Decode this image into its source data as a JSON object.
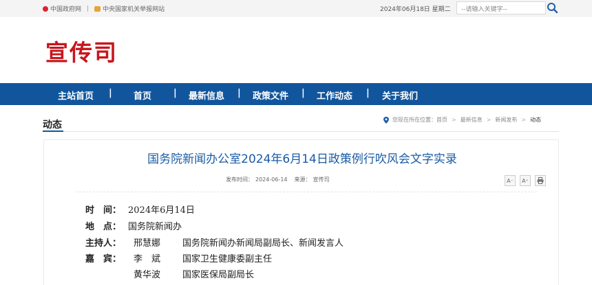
{
  "topbar": {
    "link1": "中国政府网",
    "divider": "|",
    "link2": "中央国家机关举报网站",
    "date": "2024年06月18日 星期二",
    "search_placeholder": "--请输入关键字--"
  },
  "header": {
    "brand": "宣传司"
  },
  "nav": {
    "items": [
      "主站首页",
      "首页",
      "最新信息",
      "政策文件",
      "工作动态",
      "关于我们"
    ],
    "separator": "|"
  },
  "section": {
    "title": "动态"
  },
  "breadcrumb": {
    "prefix": "您现在所在位置：",
    "items": [
      "首页",
      "最新信息",
      "新闻发布",
      "动态"
    ],
    "arrow": ">"
  },
  "article": {
    "title": "国务院新闻办公室2024年6月14日政策例行吹风会文字实录",
    "meta_date_label": "发布时间：",
    "meta_date": "2024-06-14",
    "meta_source_label": "来源：",
    "meta_source": "宣传司",
    "tool_decrease": "A⁻",
    "tool_increase": "A⁺",
    "rows": [
      {
        "label": "时　间：",
        "value": "2024年6月14日"
      },
      {
        "label": "地　点：",
        "value": "国务院新闻办"
      },
      {
        "label": "主持人：",
        "name": "邢慧娜",
        "title": "国务院新闻办新闻局副局长、新闻发言人"
      },
      {
        "label": "嘉　宾：",
        "name": "李　斌",
        "title": "国家卫生健康委副主任"
      },
      {
        "label": "",
        "name": "黄华波",
        "title": "国家医保局副局长"
      }
    ]
  },
  "colors": {
    "brand_red": "#c8161d",
    "nav_blue": "#11569d",
    "title_blue": "#1a5ba4"
  }
}
